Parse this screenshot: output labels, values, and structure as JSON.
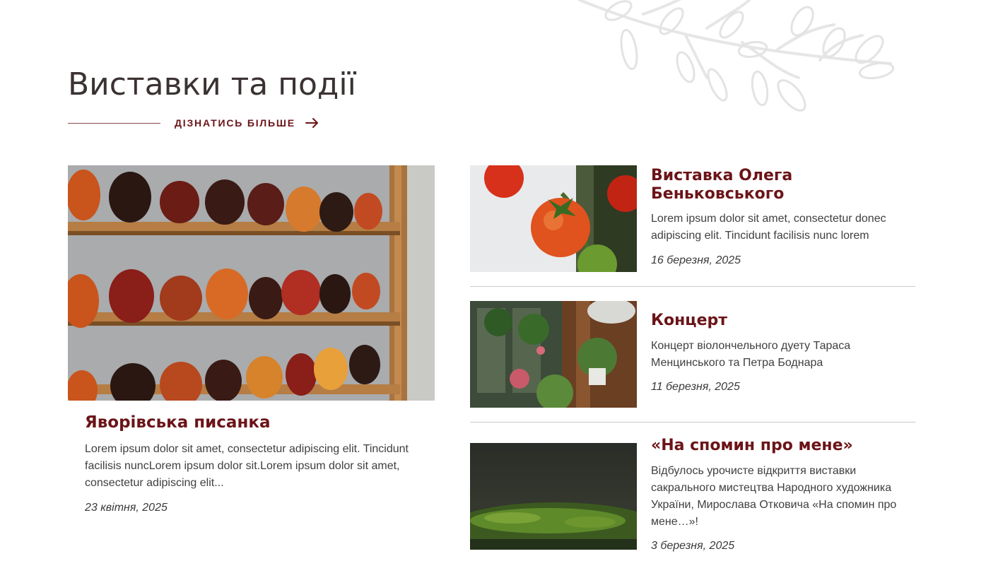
{
  "section": {
    "title": "Виставки та події",
    "more_label": "ДІЗНАТИСЬ БІЛЬШЕ"
  },
  "colors": {
    "accent": "#6b1418",
    "text": "#3f3f3f",
    "divider": "#c9c9c9"
  },
  "featured": {
    "image": "pysanky-shelf-photo",
    "title": "Яворівська писанка",
    "description": "Lorem ipsum dolor sit amet, consectetur adipiscing elit. Tincidunt facilisis nuncLorem ipsum dolor sit.Lorem ipsum dolor sit amet, consectetur adipiscing elit...",
    "date": "23 квітня, 2025"
  },
  "events": [
    {
      "image": "tomatoes-photo",
      "title": "Виставка Олега Беньковського",
      "description": "Lorem ipsum dolor sit amet, consectetur donec adipiscing elit. Tincidunt facilisis nunc lorem",
      "date": "16 березня, 2025"
    },
    {
      "image": "greenhouse-plants-photo",
      "title": "Концерт",
      "description": "Концерт віолончельного дуету Тараса Менцинського та Петра Боднара",
      "date": "11 березня, 2025"
    },
    {
      "image": "moss-photo",
      "title": "«На спомин про мене»",
      "description": "Відбулось урочисте відкриття виставки сакрального мистецтва Народного художника України, Мирослава Отковича «На спомин про мене…»!",
      "date": "3 березня, 2025"
    }
  ]
}
